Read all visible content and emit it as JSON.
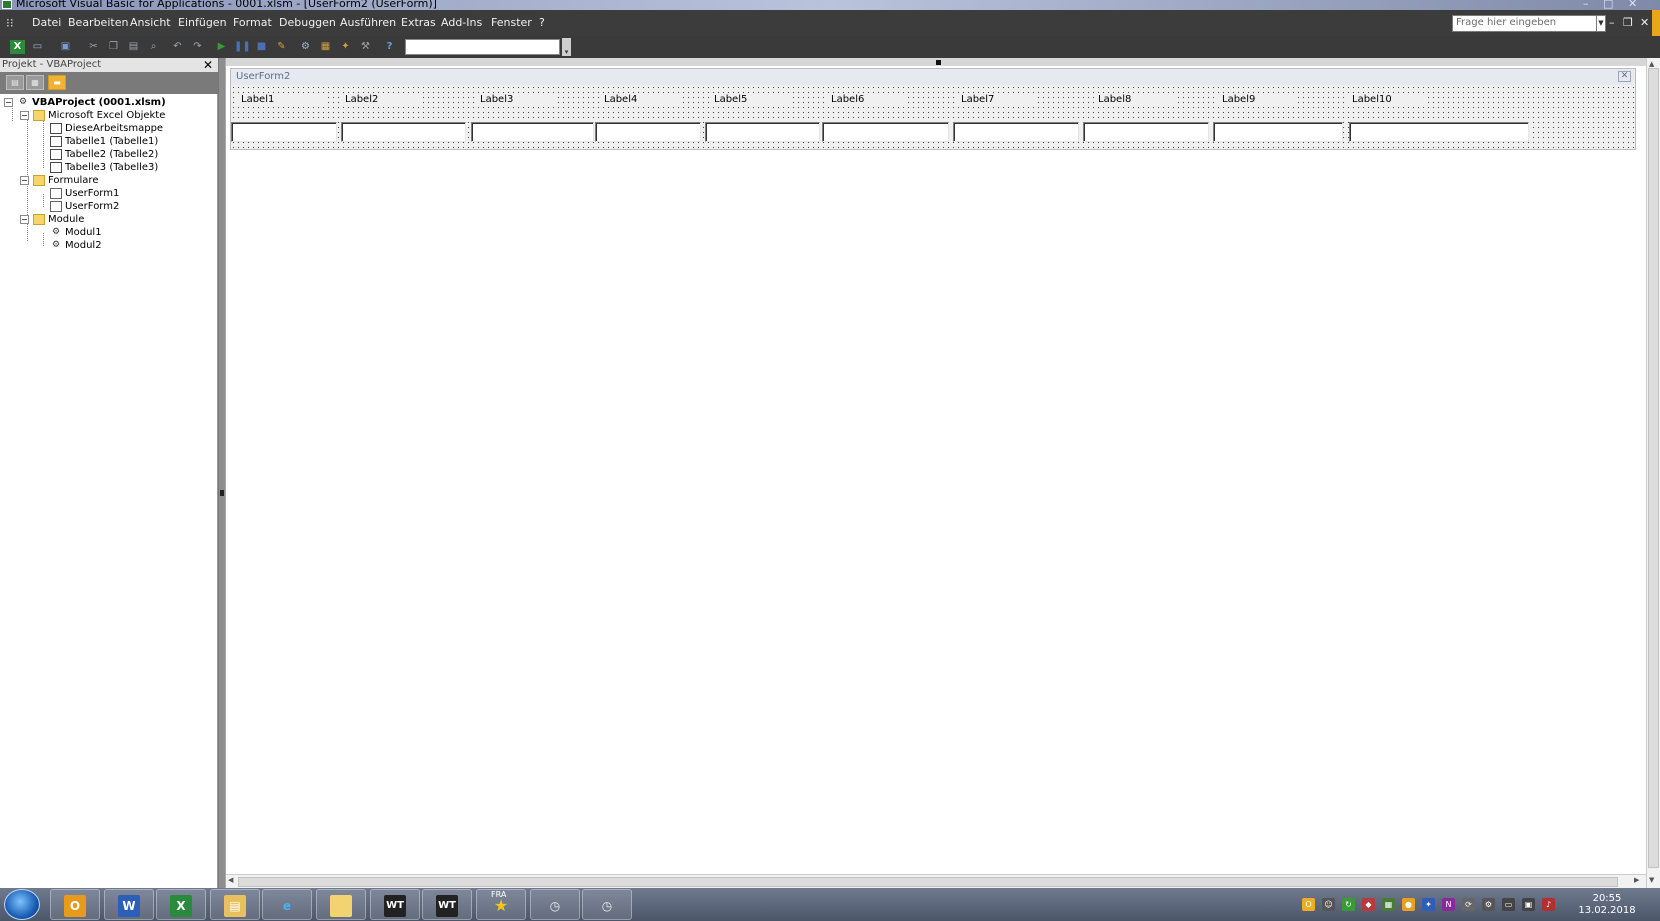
{
  "window": {
    "title": "Microsoft Visual Basic for Applications - 0001.xlsm - [UserForm2 (UserForm)]",
    "controls": [
      "–",
      "□",
      "✕"
    ]
  },
  "menubar": {
    "items": [
      "Datei",
      "Bearbeiten",
      "Ansicht",
      "Einfügen",
      "Format",
      "Debuggen",
      "Ausführen",
      "Extras",
      "Add-Ins",
      "Fenster",
      "?"
    ],
    "ask_placeholder": "Frage hier eingeben",
    "mdi_controls": [
      "–",
      "❒",
      "✕"
    ]
  },
  "toolbar": {
    "buttons": [
      "excel",
      "insert-userform",
      "save",
      "cut",
      "copy",
      "paste",
      "find",
      "undo",
      "redo",
      "run",
      "pause",
      "reset",
      "design-mode",
      "project-explorer",
      "properties",
      "object-browser",
      "toolbox",
      "help"
    ]
  },
  "project_panel": {
    "title": "Projekt - VBAProject",
    "root": "VBAProject (0001.xlsm)",
    "groups": [
      {
        "label": "Microsoft Excel Objekte",
        "children": [
          "DieseArbeitsmappe",
          "Tabelle1 (Tabelle1)",
          "Tabelle2 (Tabelle2)",
          "Tabelle3 (Tabelle3)"
        ]
      },
      {
        "label": "Formulare",
        "children": [
          "UserForm1",
          "UserForm2"
        ]
      },
      {
        "label": "Module",
        "children": [
          "Modul1",
          "Modul2"
        ]
      }
    ]
  },
  "userform": {
    "title": "UserForm2",
    "labels": [
      "Label1",
      "Label2",
      "Label3",
      "Label4",
      "Label5",
      "Label6",
      "Label7",
      "Label8",
      "Label9",
      "Label10"
    ]
  },
  "taskbar": {
    "apps": [
      "Outlook",
      "Word",
      "Excel",
      "Explorer",
      "Internet Explorer",
      "Ordner",
      "WT",
      "WT",
      "FRA",
      "Zeiterfassung",
      "Zeiterfassung 2"
    ],
    "fra_label": "FRA",
    "wt_label": "WT",
    "clock_time": "20:55",
    "clock_date": "13.02.2018"
  },
  "colors": {
    "menubar_bg": "#3c3c3c",
    "accent": "#e8a81b",
    "taskbar": "#566174"
  }
}
